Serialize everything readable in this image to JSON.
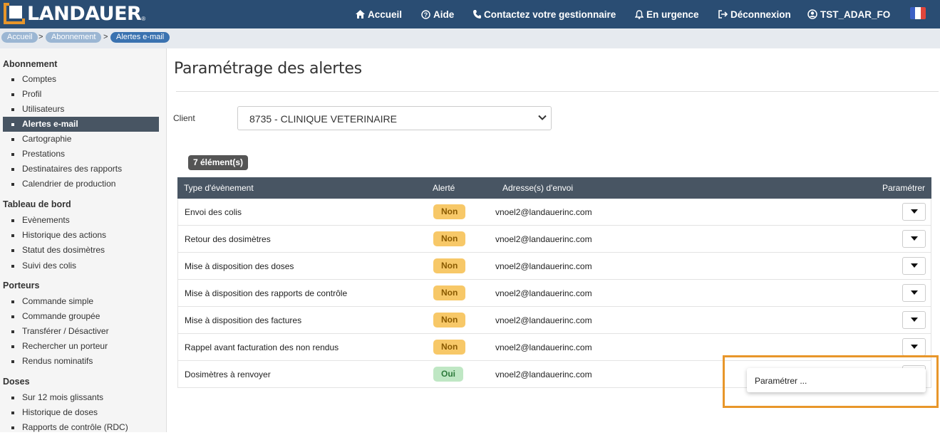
{
  "brand": {
    "name": "LANDAUER",
    "reg": "®"
  },
  "nav": {
    "home": "Accueil",
    "help": "Aide",
    "contact": "Contactez votre gestionnaire",
    "urgent": "En urgence",
    "logout": "Déconnexion",
    "user": "TST_ADAR_FO"
  },
  "breadcrumb": [
    "Accueil",
    "Abonnement",
    "Alertes e-mail"
  ],
  "sidebar": {
    "sections": [
      {
        "title": "Abonnement",
        "items": [
          "Comptes",
          "Profil",
          "Utilisateurs",
          "Alertes e-mail",
          "Cartographie",
          "Prestations",
          "Destinataires des rapports",
          "Calendrier de production"
        ]
      },
      {
        "title": "Tableau de bord",
        "items": [
          "Evènements",
          "Historique des actions",
          "Statut des dosimètres",
          "Suivi des colis"
        ]
      },
      {
        "title": "Porteurs",
        "items": [
          "Commande simple",
          "Commande groupée",
          "Transférer / Désactiver",
          "Rechercher un porteur",
          "Rendus nominatifs"
        ]
      },
      {
        "title": "Doses",
        "items": [
          "Sur 12 mois glissants",
          "Historique de doses",
          "Rapports de contrôle (RDC)"
        ]
      }
    ],
    "active": "Alertes e-mail"
  },
  "page": {
    "title": "Paramétrage des alertes",
    "client_label": "Client",
    "client_value": "8735 - CLINIQUE VETERINAIRE",
    "count": "7 élément(s)"
  },
  "table": {
    "headers": [
      "Type d'évènement",
      "Alerté",
      "Adresse(s) d'envoi",
      "Paramétrer"
    ],
    "rows": [
      {
        "type": "Envoi des colis",
        "alert": "Non",
        "address": "vnoel2@landauerinc.com"
      },
      {
        "type": "Retour des dosimètres",
        "alert": "Non",
        "address": "vnoel2@landauerinc.com"
      },
      {
        "type": "Mise à disposition des doses",
        "alert": "Non",
        "address": "vnoel2@landauerinc.com"
      },
      {
        "type": "Mise à disposition des rapports de contrôle",
        "alert": "Non",
        "address": "vnoel2@landauerinc.com"
      },
      {
        "type": "Mise à disposition des factures",
        "alert": "Non",
        "address": "vnoel2@landauerinc.com"
      },
      {
        "type": "Rappel avant facturation des non rendus",
        "alert": "Non",
        "address": "vnoel2@landauerinc.com"
      },
      {
        "type": "Dosimètres à renvoyer",
        "alert": "Oui",
        "address": "vnoel2@landauerinc.com"
      }
    ]
  },
  "dropdown": {
    "item": "Paramétrer ..."
  },
  "colors": {
    "topbar": "#2a4d73",
    "accent": "#e8962a",
    "table_header": "#485563",
    "pill_non": "#f7c868",
    "pill_oui": "#bfe7c4"
  }
}
